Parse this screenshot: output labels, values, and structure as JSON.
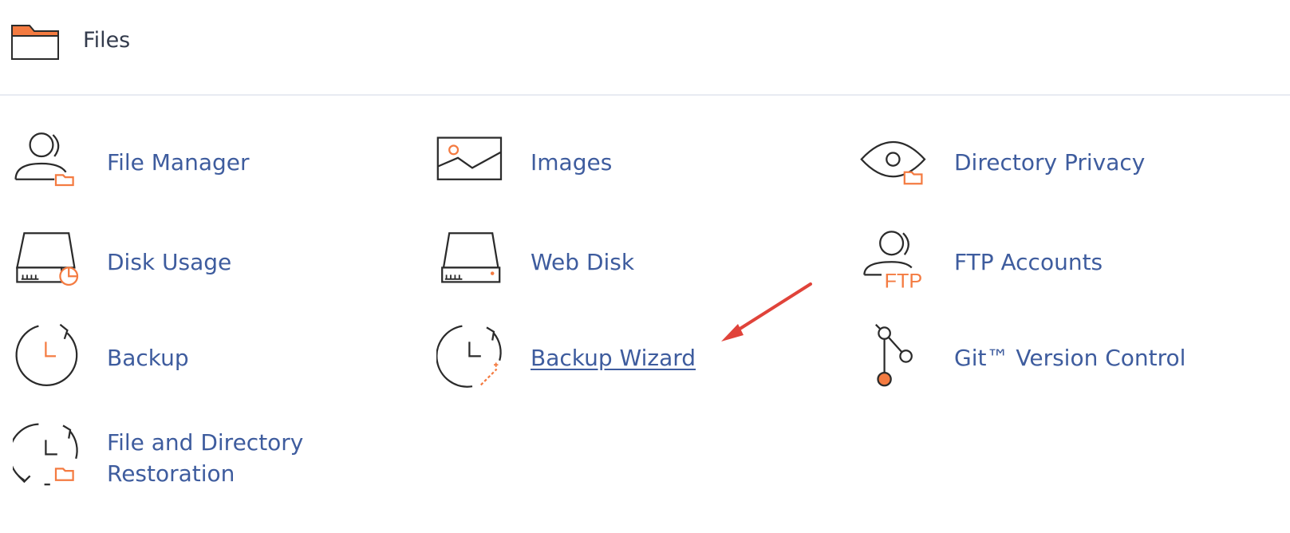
{
  "section": {
    "title": "Files",
    "icon": "folder-icon"
  },
  "items": [
    {
      "id": "file-manager",
      "label": "File Manager",
      "icon": "user-folder-icon"
    },
    {
      "id": "images",
      "label": "Images",
      "icon": "image-icon"
    },
    {
      "id": "directory-privacy",
      "label": "Directory Privacy",
      "icon": "eye-folder-icon"
    },
    {
      "id": "disk-usage",
      "label": "Disk Usage",
      "icon": "disk-pie-icon"
    },
    {
      "id": "web-disk",
      "label": "Web Disk",
      "icon": "disk-icon"
    },
    {
      "id": "ftp-accounts",
      "label": "FTP Accounts",
      "icon": "user-ftp-icon"
    },
    {
      "id": "backup",
      "label": "Backup",
      "icon": "clock-refresh-icon"
    },
    {
      "id": "backup-wizard",
      "label": "Backup Wizard",
      "icon": "clock-wand-icon",
      "hovered": true
    },
    {
      "id": "git-version-control",
      "label": "Git™ Version Control",
      "icon": "git-branch-icon"
    },
    {
      "id": "file-directory-restoration",
      "label_line1": "File and Directory",
      "label_line2": "Restoration",
      "icon": "clock-restore-folder-icon"
    }
  ],
  "colors": {
    "accent": "#f47b41",
    "link": "#3e5c9e",
    "icon_stroke": "#2b2b2b",
    "annotation": "#e0433a"
  }
}
